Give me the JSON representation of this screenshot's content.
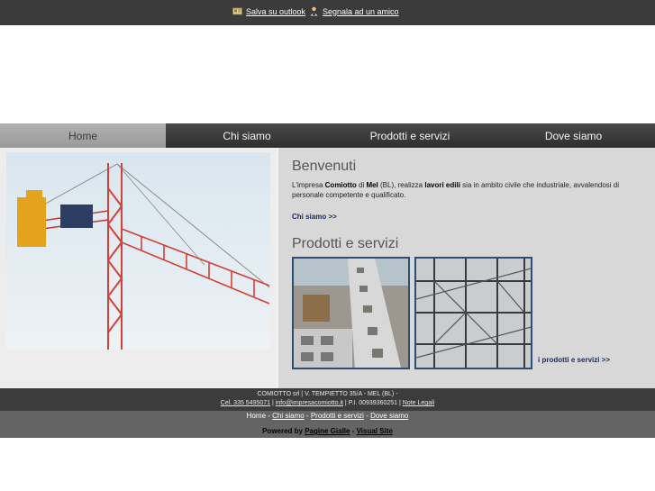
{
  "toplinks": {
    "outlook": "Salva su outlook",
    "friend": "Segnala ad un amico"
  },
  "nav": [
    {
      "label": "Home"
    },
    {
      "label": "Chi siamo"
    },
    {
      "label": "Prodotti e servizi"
    },
    {
      "label": "Dove siamo"
    }
  ],
  "welcome": {
    "title": "Benvenuti",
    "p1": "L'impresa ",
    "company": "Comiotto",
    "p2": " di ",
    "place": "Mel",
    "p3": " (BL), realizza ",
    "works": "lavori edili",
    "p4": " sia in ambito civile che industriale, avvalendosi di personale competente e qualificato.",
    "link": "Chi siamo >>"
  },
  "products": {
    "title": "Prodotti e servizi",
    "link": "i prodotti e servizi >>"
  },
  "footer": {
    "company_line": "COMIOTTO srl | V. TEMPIETTO 35/A - MEL (BL) -",
    "phone": "Cel. 335 5495071",
    "sep1": " | ",
    "email": "info@impresacomiotto.it",
    "piva": " | P.I. 00939360251 | ",
    "legal": "Note Legali",
    "nav": [
      "Home",
      "Chi siamo",
      "Prodotti e servizi",
      "Dove siamo"
    ],
    "nav_sep": " - ",
    "powered": "Powered by ",
    "pg": "Pagine Gialle",
    "dash": " - ",
    "vs": "Visual Site"
  }
}
